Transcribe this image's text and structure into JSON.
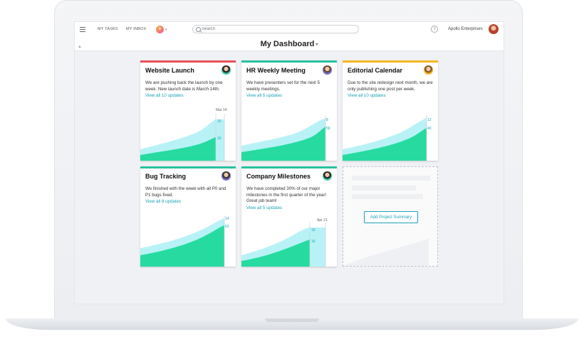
{
  "topbar": {
    "my_tasks": "MY TASKS",
    "my_inbox": "MY INBOX",
    "add_label": "+",
    "search_placeholder": "Search",
    "help_label": "?",
    "org_name": "Apollo Enterprises"
  },
  "page": {
    "title": "My Dashboard"
  },
  "cards": [
    {
      "title": "Website Launch",
      "description": "We are pushing back the launch by one week. New launch date is March 14th.",
      "link": "View all 10 updates",
      "accent": "#e8505b",
      "date_label": "Mar 14",
      "values": [
        "15",
        "10"
      ]
    },
    {
      "title": "HR Weekly Meeting",
      "description": "We have presenters set for the next 5 weekly meetings.",
      "link": "View all 5 updates",
      "accent": "#27c2a0",
      "values": [
        "8",
        "59"
      ]
    },
    {
      "title": "Editorial Calendar",
      "description": "Due to the site redesign next month, we are only publishing one post per week.",
      "link": "View all 10 updates",
      "accent": "#f5b821",
      "values": [
        "12",
        "40"
      ]
    },
    {
      "title": "Bug Tracking",
      "description": "We finished with the week with all P0 and P1 bugs fixed.",
      "link": "View all 8 updates",
      "accent": "#27c2a0",
      "values": [
        "14",
        "63"
      ]
    },
    {
      "title": "Company Milestones",
      "description": "We have completed 30% of our major milestones in the first quarter of the year! Great job team!",
      "link": "View all 5 updates",
      "accent": "#27c2a0",
      "date_label": "Apr 21",
      "values": [
        "16",
        "16"
      ]
    }
  ],
  "placeholder": {
    "button_label": "Add Project Summary"
  },
  "colors": {
    "teal_light": "#b8f2f6",
    "teal_mid": "#4fd6e4",
    "green": "#27dba0",
    "link": "#1aa3b8"
  }
}
